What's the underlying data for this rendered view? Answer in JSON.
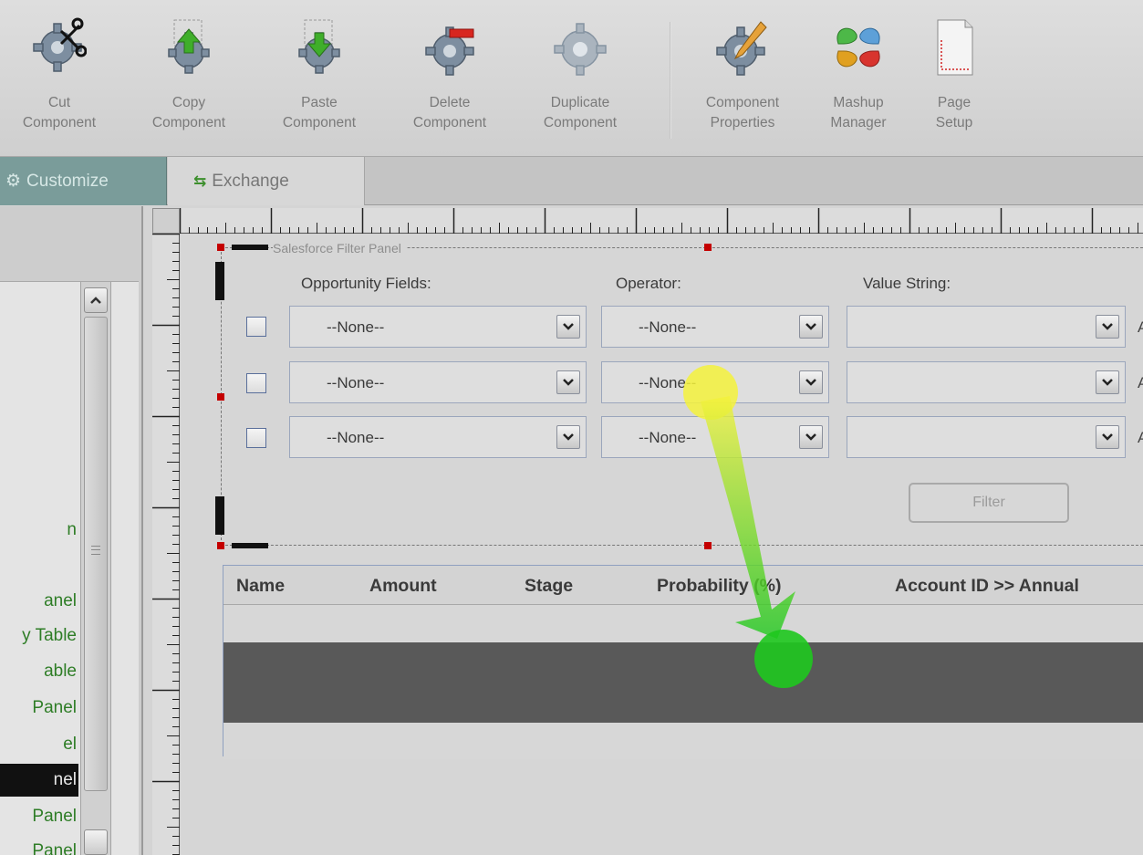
{
  "toolbar": {
    "buttons": [
      {
        "label": "Cut\nComponent",
        "icon": "cut-component-icon"
      },
      {
        "label": "Copy\nComponent",
        "icon": "copy-component-icon"
      },
      {
        "label": "Paste\nComponent",
        "icon": "paste-component-icon"
      },
      {
        "label": "Delete\nComponent",
        "icon": "delete-component-icon"
      },
      {
        "label": "Duplicate\nComponent",
        "icon": "duplicate-component-icon"
      },
      {
        "label": "Component\nProperties",
        "icon": "component-properties-icon"
      },
      {
        "label": "Mashup\nManager",
        "icon": "mashup-manager-icon"
      },
      {
        "label": "Page\nSetup",
        "icon": "page-setup-icon"
      }
    ]
  },
  "tabs": {
    "customize": {
      "label": "Customize",
      "icon_glyph": "⚙"
    },
    "exchange": {
      "label": "Exchange",
      "icon_glyph": "⇆"
    }
  },
  "left_panel": {
    "items": [
      {
        "label": "n"
      },
      {
        "label": "anel"
      },
      {
        "label": "y Table"
      },
      {
        "label": "able"
      },
      {
        "label": "Panel"
      },
      {
        "label": "el"
      },
      {
        "label": "nel",
        "selected": true
      },
      {
        "label": "Panel"
      },
      {
        "label": "Panel"
      }
    ]
  },
  "filter_panel": {
    "title": "Salesforce Filter Panel",
    "headers": {
      "fields": "Opportunity Fields:",
      "operator": "Operator:",
      "value": "Value String:"
    },
    "rows": [
      {
        "checked": false,
        "field": "--None--",
        "operator": "--None--",
        "value": "",
        "suffix": "A"
      },
      {
        "checked": false,
        "field": "--None--",
        "operator": "--None--",
        "value": "",
        "suffix": "A"
      },
      {
        "checked": false,
        "field": "--None--",
        "operator": "--None--",
        "value": "",
        "suffix": "A"
      }
    ],
    "filter_button": "Filter"
  },
  "table": {
    "columns": [
      "Name",
      "Amount",
      "Stage",
      "Probability (%)",
      "Account ID >> Annual"
    ]
  },
  "colors": {
    "accent_tab": "#7a9c9a",
    "list_text": "#2e7d26",
    "handle": "#c40000",
    "drag_start": "#f4f23c",
    "drag_end": "#1ec81e"
  }
}
